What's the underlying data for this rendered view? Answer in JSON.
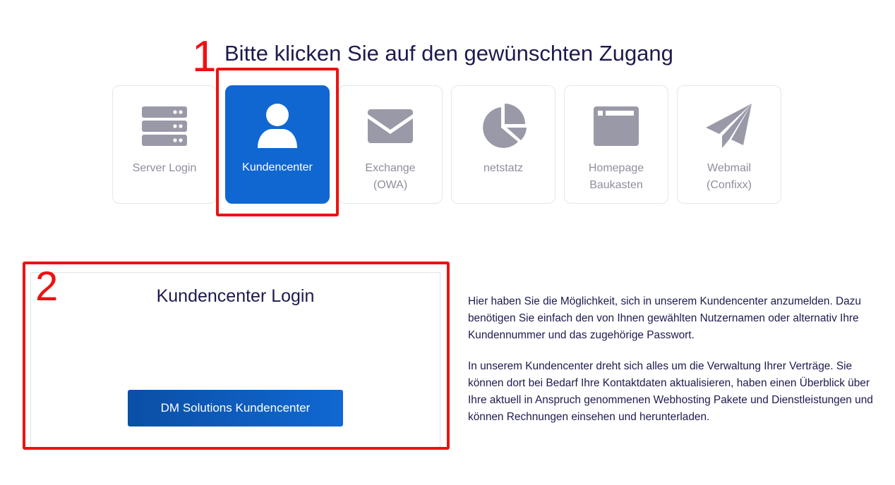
{
  "annotations": {
    "marker_1": "1",
    "marker_2": "2",
    "highlight_color": "#ee1111"
  },
  "heading": "Bitte klicken Sie auf den gewünschten Zugang",
  "tiles": [
    {
      "icon": "server-icon",
      "label_line1": "Server Login",
      "label_line2": "",
      "active": false
    },
    {
      "icon": "user-icon",
      "label_line1": "Kundencenter",
      "label_line2": "",
      "active": true
    },
    {
      "icon": "envelope-icon",
      "label_line1": "Exchange",
      "label_line2": "(OWA)",
      "active": false
    },
    {
      "icon": "pie-chart-icon",
      "label_line1": "netstatz",
      "label_line2": "",
      "active": false
    },
    {
      "icon": "browser-window-icon",
      "label_line1": "Homepage",
      "label_line2": "Baukasten",
      "active": false
    },
    {
      "icon": "paper-plane-icon",
      "label_line1": "Webmail",
      "label_line2": "(Confixx)",
      "active": false
    }
  ],
  "login": {
    "title": "Kundencenter Login",
    "button_label": "DM Solutions Kundencenter"
  },
  "description": {
    "paragraph_1": "Hier haben Sie die Möglichkeit, sich in unserem Kundencenter anzumelden. Dazu benötigen Sie einfach den von Ihnen gewählten Nutzernamen oder alternativ Ihre Kundennummer und das zugehörige Passwort.",
    "paragraph_2": "In unserem Kundencenter dreht sich alles um die Verwaltung Ihrer Verträge. Sie können dort bei Bedarf Ihre Kontaktdaten aktualisieren, haben einen Überblick über Ihre aktuell in Anspruch genommenen Webhosting Pakete und Dienstleistungen und können Rechnungen einsehen und herunterladen."
  },
  "colors": {
    "primary": "#1067d1",
    "heading_text": "#1d1a4f",
    "icon_gray": "#9a99a8",
    "label_gray": "#8e8e9d"
  }
}
